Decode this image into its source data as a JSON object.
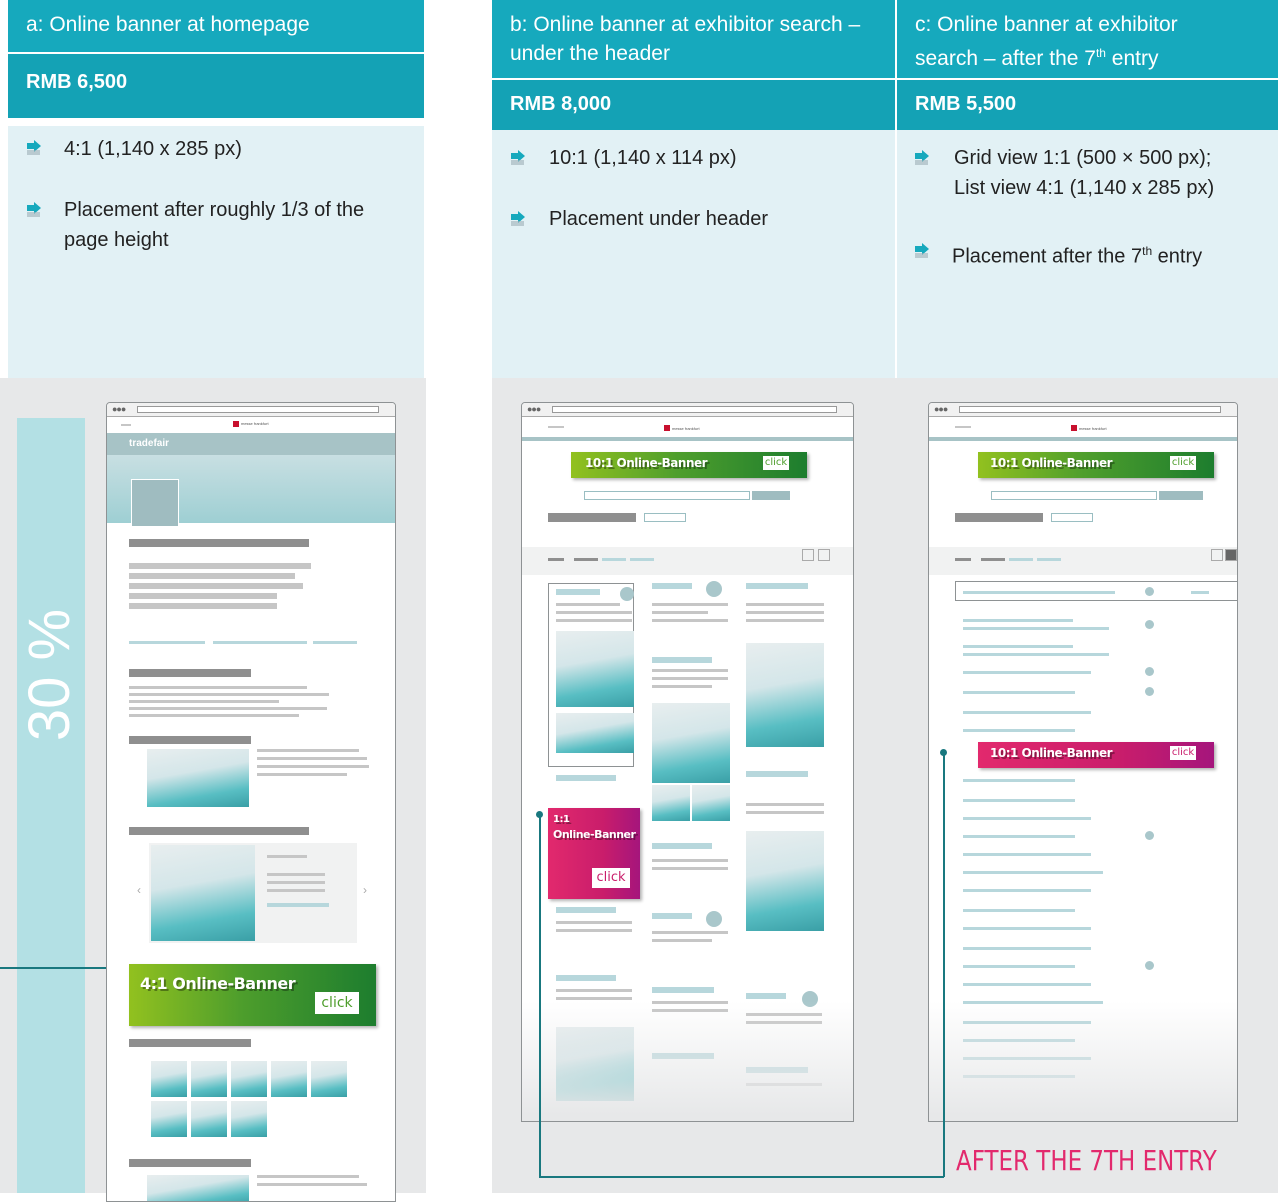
{
  "colors": {
    "header_bg": "#16a9bd",
    "price_bg": "#14a2b5",
    "spec_bg": "#e2f1f5",
    "panel_bg": "#e7e8e9",
    "green_banner": "#4e9e2c",
    "pink_banner": "#c91d6b",
    "accent_text": "#e2296d",
    "connector": "#19787f"
  },
  "columns": [
    {
      "header": "a: Online banner at homepage",
      "price": "RMB 6,500",
      "bullets": [
        "4:1 (1,140 x 285 px)",
        "Placement after roughly 1/3 of the page height"
      ]
    },
    {
      "header": "b: Online banner at exhibitor search – under the header",
      "price": "RMB 8,000",
      "bullets": [
        "10:1 (1,140 x 114 px)",
        "Placement under header"
      ]
    },
    {
      "header_line1": "c: Online banner at exhibitor",
      "header_line2": "search – after the 7",
      "header_sup": "th",
      "header_end": " entry",
      "price": "RMB 5,500",
      "bullet1_line1": "Grid view 1:1 (500 × 500 px);",
      "bullet1_line2": "List view 4:1 (1,140 x 285 px)",
      "bullet2": "Placement after the 7",
      "bullet2_sup": "th",
      "bullet2_end": " entry"
    }
  ],
  "mockups": {
    "percent_label": "30 %",
    "site_logo": "tradefair",
    "brand": "messe frankfurt",
    "banner_4_1": "4:1 Online-Banner",
    "banner_10_1": "10:1 Online-Banner",
    "banner_1_1_line1": "1:1",
    "banner_1_1_line2": "Online-Banner",
    "click": "click",
    "after_label": "AFTER THE 7TH ENTRY"
  }
}
